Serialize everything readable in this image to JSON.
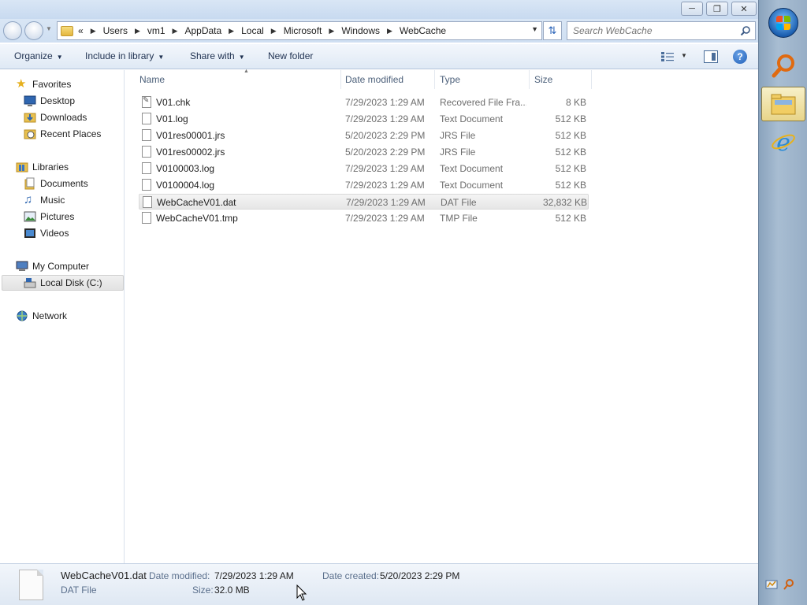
{
  "window": {
    "controls": [
      "minimize",
      "maximize",
      "close"
    ]
  },
  "address": {
    "overflow": "«",
    "breadcrumbs": [
      "Users",
      "vm1",
      "AppData",
      "Local",
      "Microsoft",
      "Windows",
      "WebCache"
    ],
    "search_placeholder": "Search WebCache"
  },
  "toolbar": {
    "organize": "Organize",
    "include_in_library": "Include in library",
    "share_with": "Share with",
    "new_folder": "New folder",
    "help": "?"
  },
  "nav": {
    "favorites": "Favorites",
    "desktop": "Desktop",
    "downloads": "Downloads",
    "recent_places": "Recent Places",
    "libraries": "Libraries",
    "documents": "Documents",
    "music": "Music",
    "pictures": "Pictures",
    "videos": "Videos",
    "my_computer": "My Computer",
    "local_disk": "Local Disk (C:)",
    "network": "Network"
  },
  "columns": {
    "name": "Name",
    "date_modified": "Date modified",
    "type": "Type",
    "size": "Size"
  },
  "files": [
    {
      "name": "V01.chk",
      "date": "7/29/2023 1:29 AM",
      "type": "Recovered File Fra...",
      "size": "8 KB"
    },
    {
      "name": "V01.log",
      "date": "7/29/2023 1:29 AM",
      "type": "Text Document",
      "size": "512 KB"
    },
    {
      "name": "V01res00001.jrs",
      "date": "5/20/2023 2:29 PM",
      "type": "JRS File",
      "size": "512 KB"
    },
    {
      "name": "V01res00002.jrs",
      "date": "5/20/2023 2:29 PM",
      "type": "JRS File",
      "size": "512 KB"
    },
    {
      "name": "V0100003.log",
      "date": "7/29/2023 1:29 AM",
      "type": "Text Document",
      "size": "512 KB"
    },
    {
      "name": "V0100004.log",
      "date": "7/29/2023 1:29 AM",
      "type": "Text Document",
      "size": "512 KB"
    },
    {
      "name": "WebCacheV01.dat",
      "date": "7/29/2023 1:29 AM",
      "type": "DAT File",
      "size": "32,832 KB"
    },
    {
      "name": "WebCacheV01.tmp",
      "date": "7/29/2023 1:29 AM",
      "type": "TMP File",
      "size": "512 KB"
    }
  ],
  "selected_index": 6,
  "details": {
    "name": "WebCacheV01.dat",
    "type": "DAT File",
    "date_modified_label": "Date modified:",
    "date_modified_value": "7/29/2023 1:29 AM",
    "size_label": "Size:",
    "size_value": "32.0 MB",
    "date_created_label": "Date created:",
    "date_created_value": "5/20/2023 2:29 PM"
  },
  "colors": {
    "accent": "#1f5fb8",
    "folder": "#e4b63f"
  }
}
